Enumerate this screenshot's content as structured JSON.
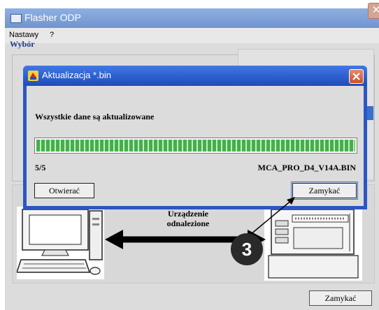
{
  "main_window": {
    "title": "Flasher ODP",
    "menu": [
      {
        "label": "Nastawy"
      },
      {
        "label": "?"
      }
    ],
    "group_label": "Wybór",
    "device_label_line1": "Urządzenie",
    "device_label_line2": "odnalezione",
    "close_button": "Zamykać"
  },
  "dialog": {
    "title": "Aktualizacja *.bin",
    "status": "Wszystkie dane są aktualizowane",
    "progress_current": 5,
    "progress_total": 5,
    "count_text": "5/5",
    "filename": "MCA_PRO_D4_V14A.BIN",
    "open_button": "Otwierać",
    "close_button": "Zamykać"
  },
  "callout": {
    "number": "3"
  },
  "colors": {
    "titlebar_blue": "#2b57c4",
    "progress_green": "#43b04a",
    "callout_dark": "#2a2a2a"
  }
}
